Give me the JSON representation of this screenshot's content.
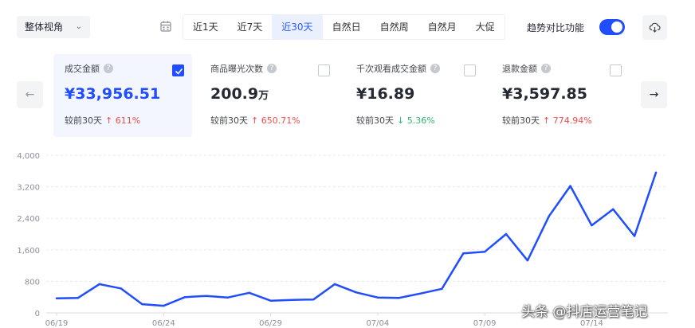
{
  "view_select": {
    "label": "整体视角"
  },
  "date_tabs": [
    {
      "label": "近1天",
      "active": false
    },
    {
      "label": "近7天",
      "active": false
    },
    {
      "label": "近30天",
      "active": true
    },
    {
      "label": "自然日",
      "active": false
    },
    {
      "label": "自然周",
      "active": false
    },
    {
      "label": "自然月",
      "active": false
    },
    {
      "label": "大促",
      "active": false
    }
  ],
  "trend_compare": {
    "label": "趋势对比功能",
    "enabled": true
  },
  "cards": [
    {
      "title": "成交金额",
      "value": "¥33,956.51",
      "unit": "",
      "compare_label": "较前30天",
      "change": "611%",
      "direction": "up",
      "checked": true
    },
    {
      "title": "商品曝光次数",
      "value": "200.9",
      "unit": "万",
      "compare_label": "较前30天",
      "change": "650.71%",
      "direction": "up",
      "checked": false
    },
    {
      "title": "千次观看成交金额",
      "value": "¥16.89",
      "unit": "",
      "compare_label": "较前30天",
      "change": "5.36%",
      "direction": "down",
      "checked": false
    },
    {
      "title": "退款金额",
      "value": "¥3,597.85",
      "unit": "",
      "compare_label": "较前30天",
      "change": "774.94%",
      "direction": "up",
      "checked": false
    }
  ],
  "icons": {
    "calendar": "calendar-icon",
    "download": "download-icon",
    "prev": "arrow-left-icon",
    "next": "arrow-right-icon"
  },
  "colors": {
    "accent": "#1f4dff",
    "up": "#f24b4b",
    "down": "#2db571"
  },
  "chart_data": {
    "type": "line",
    "ylim": [
      0,
      4000
    ],
    "yticks": [
      "0",
      "800",
      "1,600",
      "2,400",
      "3,200",
      "4,000"
    ],
    "ytick_values": [
      0,
      800,
      1600,
      2400,
      3200,
      4000
    ],
    "xtick_labels": [
      "06/19",
      "06/24",
      "06/29",
      "07/04",
      "07/09",
      "07/14"
    ],
    "xtick_index": [
      0,
      5,
      10,
      15,
      20,
      25
    ],
    "grid": true,
    "series": [
      {
        "values": [
          370,
          380,
          730,
          620,
          220,
          180,
          400,
          430,
          390,
          510,
          310,
          330,
          340,
          730,
          520,
          390,
          380,
          490,
          610,
          1510,
          1550,
          2000,
          1330,
          2450,
          3220,
          2220,
          2630,
          1950,
          3560
        ]
      }
    ]
  },
  "watermark": "头条 @抖店运营笔记"
}
